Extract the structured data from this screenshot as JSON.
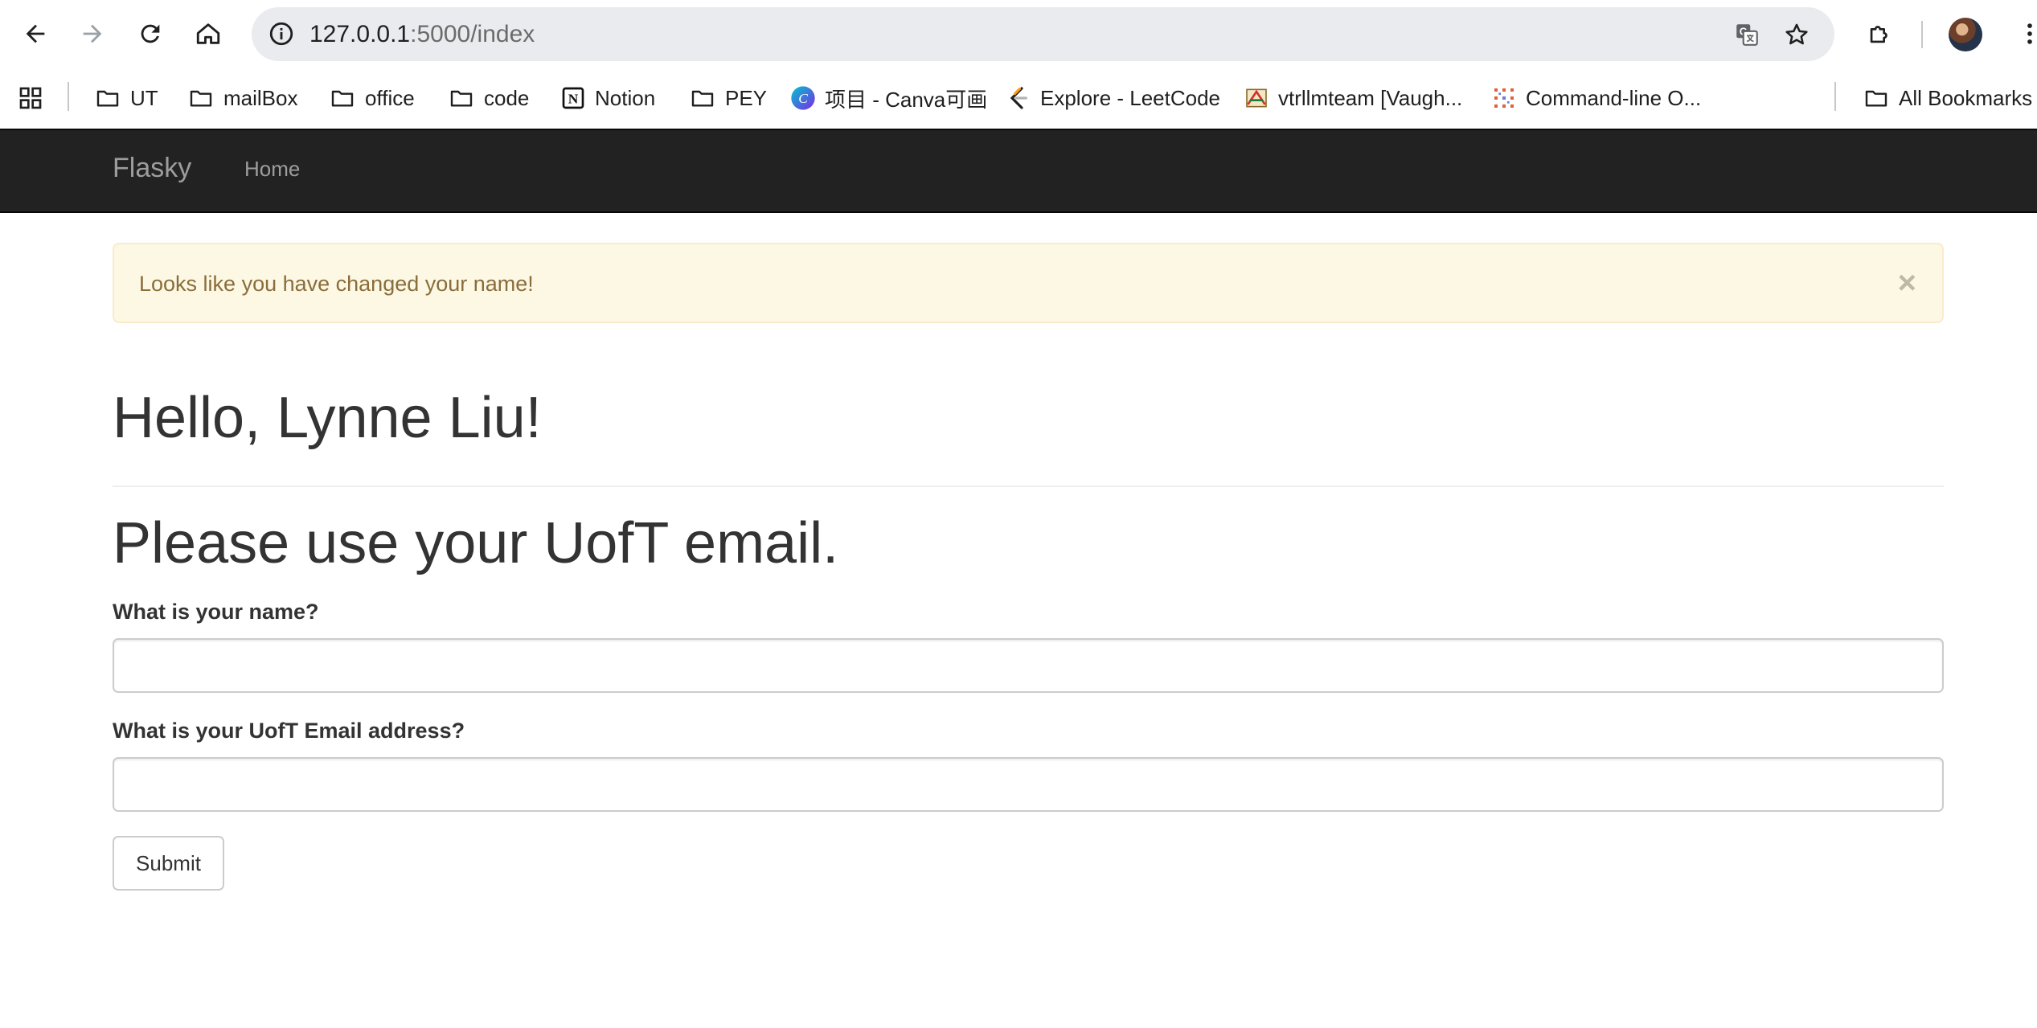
{
  "browser": {
    "url_host": "127.0.0.1",
    "url_path": ":5000/index",
    "icons": {
      "back": "back-arrow-icon",
      "forward": "forward-arrow-icon",
      "reload": "reload-icon",
      "home": "home-icon",
      "site_info": "site-info-icon",
      "translate": "translate-icon",
      "bookmark_star": "star-icon",
      "extensions": "puzzle-icon",
      "menu": "kebab-menu-icon"
    }
  },
  "bookmarks": {
    "items": [
      {
        "label": "UT",
        "icon": "folder-icon"
      },
      {
        "label": "mailBox",
        "icon": "folder-icon"
      },
      {
        "label": "office",
        "icon": "folder-icon"
      },
      {
        "label": "code",
        "icon": "folder-icon"
      },
      {
        "label": "Notion",
        "icon": "notion-icon"
      },
      {
        "label": "PEY",
        "icon": "folder-icon"
      },
      {
        "label": "项目 - Canva可画",
        "icon": "canva-icon"
      },
      {
        "label": "Explore - LeetCode",
        "icon": "leetcode-icon"
      },
      {
        "label": "vtrllmteam [Vaugh...",
        "icon": "vtrl-icon"
      },
      {
        "label": "Command-line O...",
        "icon": "command-line-icon"
      }
    ],
    "all_bookmarks": "All Bookmarks"
  },
  "navbar": {
    "brand": "Flasky",
    "home": "Home"
  },
  "alert": {
    "message": "Looks like you have changed your name!",
    "close": "×"
  },
  "main": {
    "greeting": "Hello, Lynne Liu!",
    "subheading": "Please use your UofT email.",
    "name_label": "What is your name?",
    "name_value": "",
    "email_label": "What is your UofT Email address?",
    "email_value": "",
    "submit_label": "Submit"
  },
  "colors": {
    "navbar_bg": "#222222",
    "navbar_text": "#9d9d9d",
    "alert_bg": "#fcf8e3",
    "alert_border": "#faebcc",
    "alert_text": "#8a6d3b"
  }
}
